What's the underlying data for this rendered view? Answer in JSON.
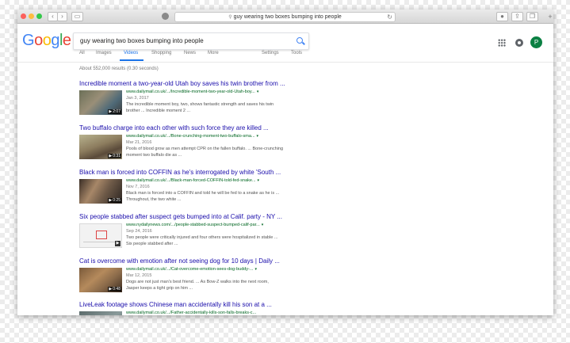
{
  "browser": {
    "url_text": "guy wearing two boxes bumping into people",
    "nav_back": "‹",
    "nav_forward": "›",
    "reload": "↻",
    "new_tab": "+"
  },
  "google": {
    "logo_letters": [
      {
        "ch": "G",
        "color": "#4285f4"
      },
      {
        "ch": "o",
        "color": "#ea4335"
      },
      {
        "ch": "o",
        "color": "#fbbc05"
      },
      {
        "ch": "g",
        "color": "#4285f4"
      },
      {
        "ch": "l",
        "color": "#34a853"
      },
      {
        "ch": "e",
        "color": "#ea4335"
      }
    ],
    "query": "guy wearing two boxes bumping into people",
    "avatar_letter": "P",
    "tabs": {
      "all": "All",
      "images": "Images",
      "videos": "Videos",
      "shopping": "Shopping",
      "news": "News",
      "more": "More",
      "settings": "Settings",
      "tools": "Tools"
    },
    "results_count": "About 552,000 results (0.30 seconds)"
  },
  "results": [
    {
      "title": "Incredible moment a two-year-old Utah boy saves his twin brother from ...",
      "url": "www.dailymail.co.uk/.../Incredible-moment-two-year-old-Utah-boy...",
      "date": "Jan 3, 2017",
      "snippet1": "The incredible moment boy, two, shows fantastic strength and saves his twin",
      "snippet2": "brother ... Incredible moment 2 ...",
      "duration": "2:07"
    },
    {
      "title": "Two buffalo charge into each other with such force they are killed ...",
      "url": "www.dailymail.co.uk/.../Bone-crunching-moment-two-buffalo-sma...",
      "date": "Mar 21, 2016",
      "snippet1": "Pools of blood grow as men attempt CPR on the fallen buffalo. ... Bone-crunching",
      "snippet2": "moment two buffalo die as ...",
      "duration": "0:31"
    },
    {
      "title": "Black man is forced into COFFIN as he's interrogated by white 'South ...",
      "url": "www.dailymail.co.uk/.../Black-man-forced-COFFIN-told-fed-snake...",
      "date": "Nov 7, 2016",
      "snippet1": "Black man is forced into a COFFIN and told he will be fed to a snake as he is ...",
      "snippet2": "Throughout, the two white ...",
      "duration": "0:25"
    },
    {
      "title": "Six people stabbed after suspect gets bumped into at Calif. party - NY ...",
      "url": "www.nydailynews.com/.../people-stabbed-suspect-bumped-calif-par...",
      "date": "Sep 24, 2016",
      "snippet1": "Two people were critically injured and four others were hospitalized in stable ...",
      "snippet2": "Six people stabbed after ...",
      "duration": ""
    },
    {
      "title": "Cat is overcome with emotion after not seeing dog for 10 days | Daily ...",
      "url": "www.dailymail.co.uk/.../Cat-overcome-emotion-sees-dog-buddy-...",
      "date": "Mar 12, 2015",
      "snippet1": "Dogs are not just man's best friend. ... As Bow-Z walks into the next room,",
      "snippet2": "Jasper keeps a tight grip on him ...",
      "duration": "0:48"
    },
    {
      "title": "LiveLeak footage shows Chinese man accidentally kill his son at a ...",
      "url": "www.dailymail.co.uk/.../Father-accidentally-kills-son-falls-breaks-c...",
      "date": "",
      "snippet1": "",
      "snippet2": "",
      "duration": ""
    }
  ]
}
